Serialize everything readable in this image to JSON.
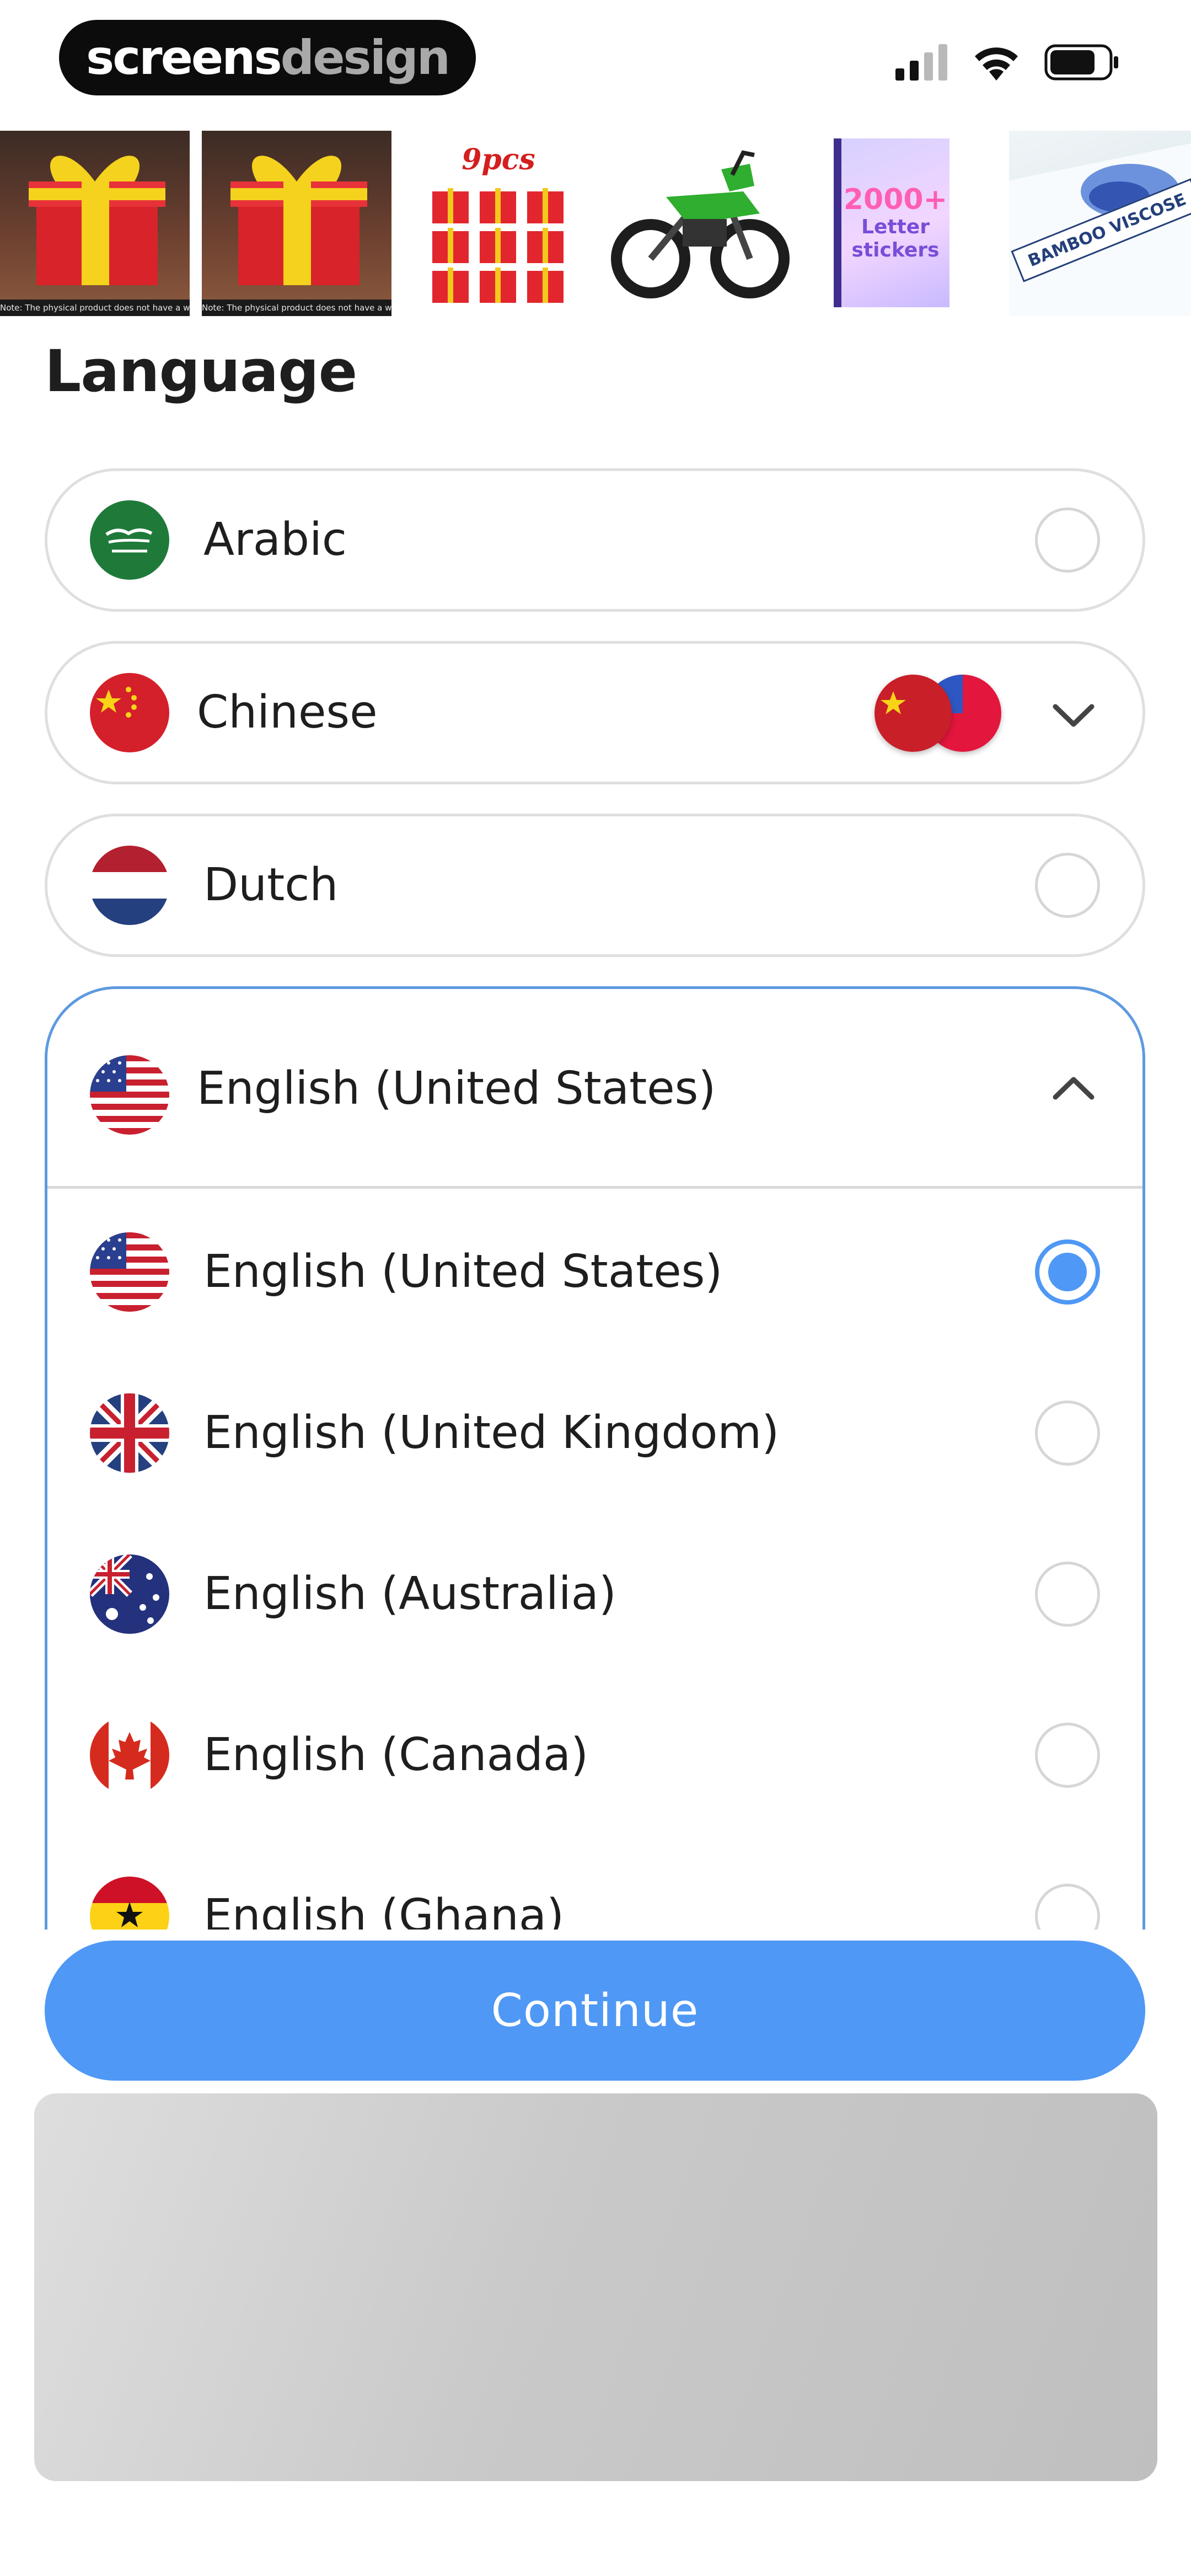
{
  "status_bar": {
    "brand_part1": "screens",
    "brand_part2": "design",
    "icons": [
      "signal-icon",
      "wifi-icon",
      "battery-icon"
    ]
  },
  "products": [
    {
      "icon": "gift-box-icon",
      "note": "Note: The physical product does not have a watermark"
    },
    {
      "icon": "gift-box-icon",
      "note": "Note: The physical product does not have a watermark"
    },
    {
      "icon": "gift-boxes-bundle-icon",
      "label": "9pcs"
    },
    {
      "icon": "dirt-bike-icon"
    },
    {
      "icon": "sticker-book-icon",
      "line1": "2000+",
      "line2": "Letter",
      "line3": "stickers"
    },
    {
      "icon": "mattress-protector-icon",
      "label": "BAMBOO VISCOSE"
    }
  ],
  "language": {
    "title": "Language",
    "options": [
      {
        "label": "Arabic",
        "state": "unselected"
      },
      {
        "label": "Chinese",
        "state": "collapsed-group"
      },
      {
        "label": "Dutch",
        "state": "unselected"
      }
    ],
    "expanded_group": {
      "label": "English (United States)",
      "items": [
        {
          "label": "English (United States)",
          "selected": true
        },
        {
          "label": "English (United Kingdom)",
          "selected": false
        },
        {
          "label": "English (Australia)",
          "selected": false
        },
        {
          "label": "English (Canada)",
          "selected": false
        },
        {
          "label": "English (Ghana)",
          "selected": false
        }
      ]
    }
  },
  "continue_label": "Continue",
  "colors": {
    "accent": "#4f98f5",
    "panel_border": "#5d9ae0",
    "row_border": "#dfdfdf",
    "text": "#1e1e1e"
  }
}
